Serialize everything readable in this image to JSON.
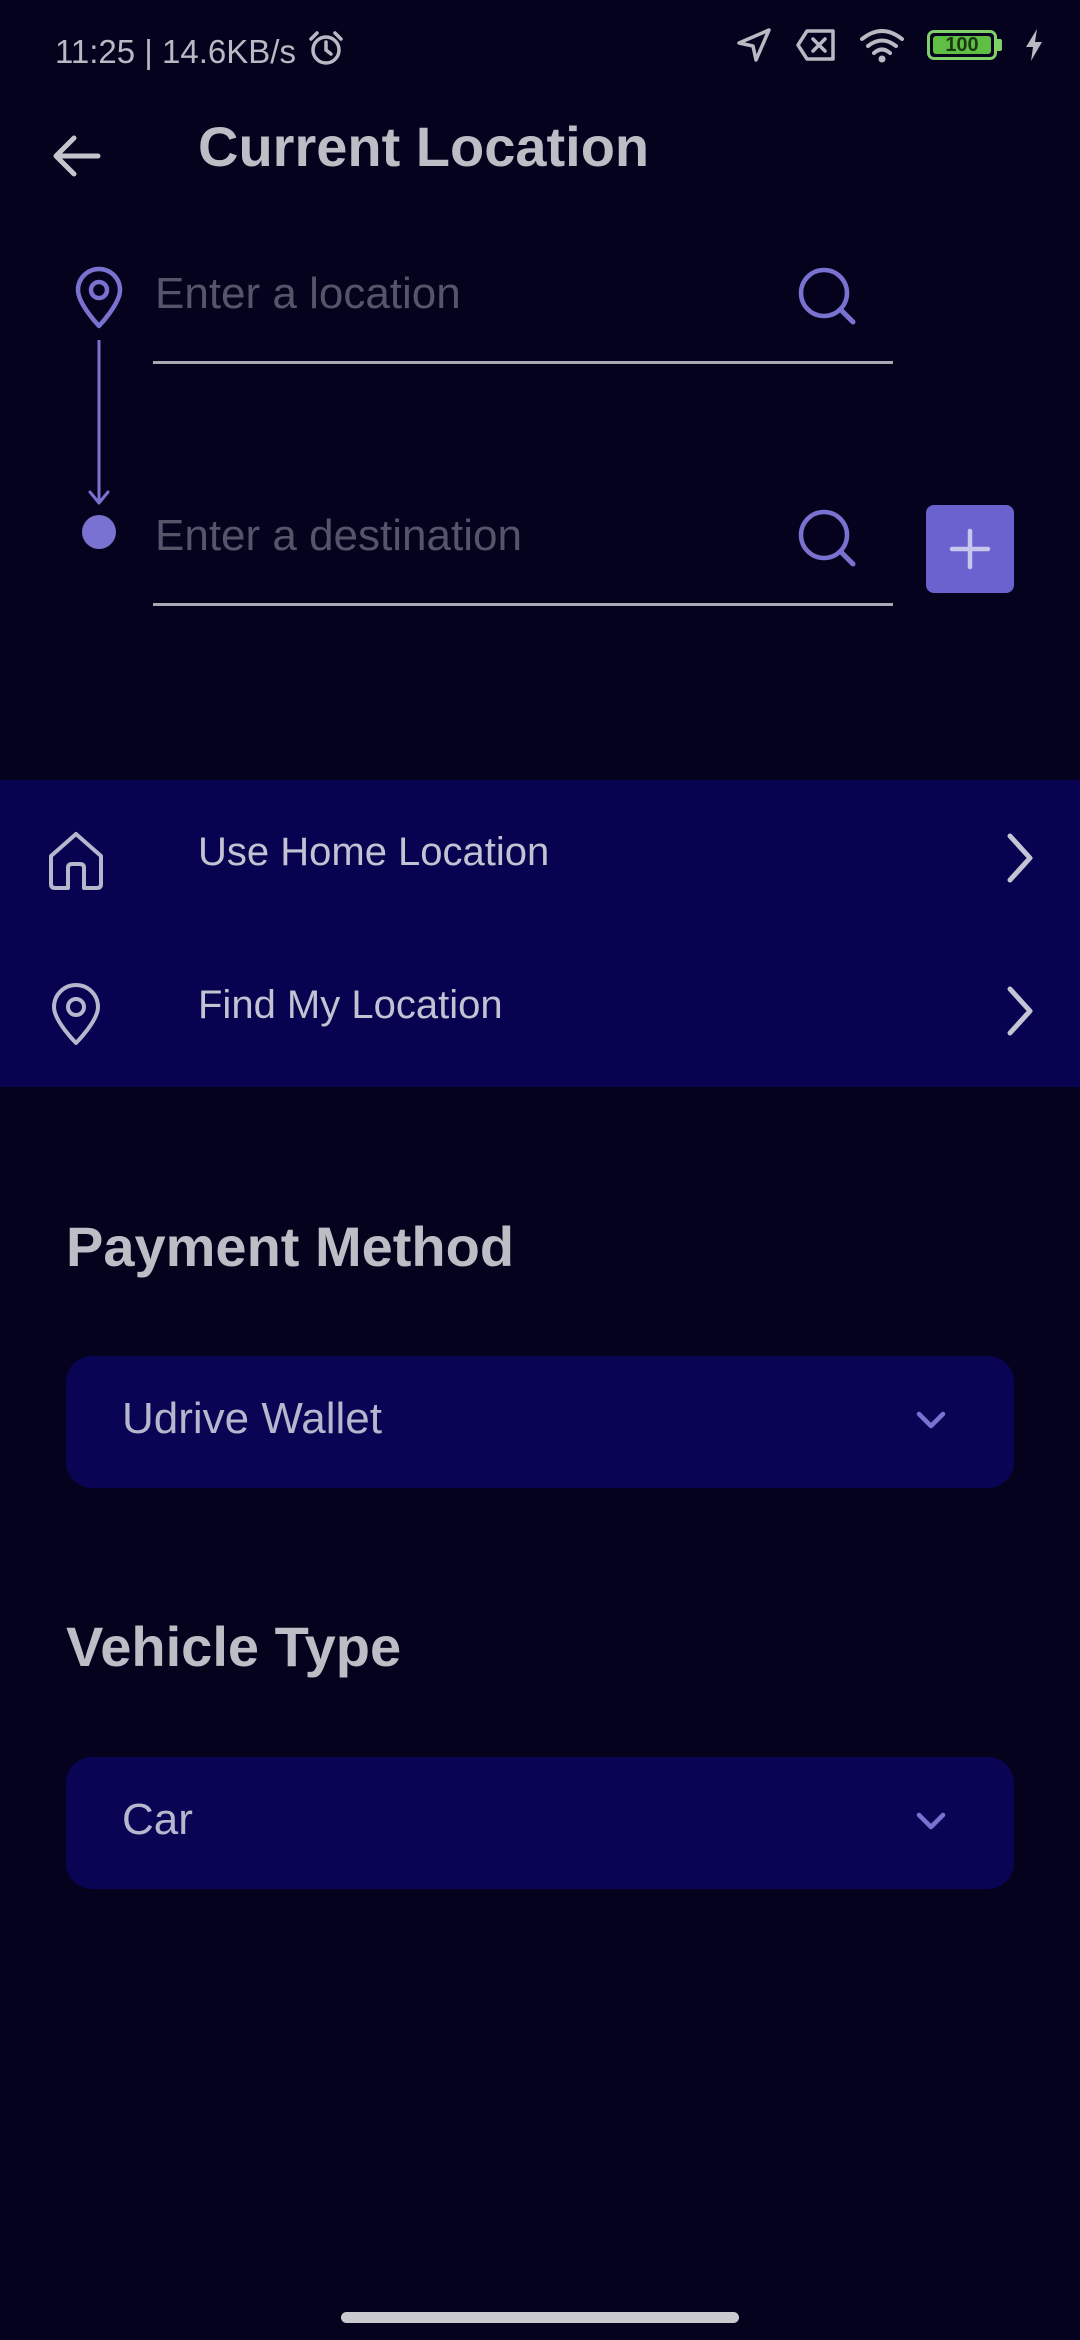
{
  "status_bar": {
    "time_speed": "11:25 | 14.6KB/s",
    "battery": "100"
  },
  "header": {
    "title": "Current Location"
  },
  "route": {
    "origin_placeholder": "Enter a location",
    "destination_placeholder": "Enter a destination"
  },
  "quick_options": [
    {
      "label": "Use Home Location"
    },
    {
      "label": "Find My Location"
    }
  ],
  "payment": {
    "title": "Payment Method",
    "selected": "Udrive Wallet"
  },
  "vehicle": {
    "title": "Vehicle Type",
    "selected": "Car"
  },
  "colors": {
    "background": "#04021c",
    "panel": "#070350",
    "accent": "#6a62cf",
    "dropdown": "#0a0455"
  }
}
